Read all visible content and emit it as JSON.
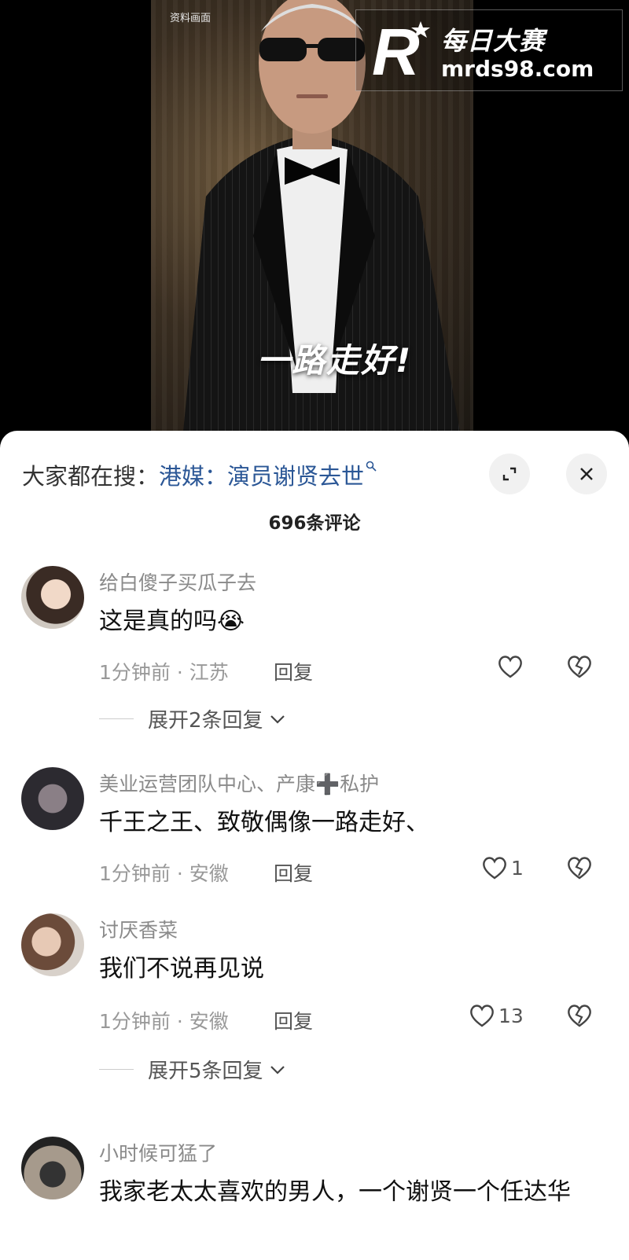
{
  "video": {
    "source_label": "资料画面",
    "caption": "一路走好!",
    "watermark": {
      "logo": "R",
      "name": "每日大赛",
      "url": "mrds98.com"
    }
  },
  "sheet": {
    "search_prefix": "大家都在搜：",
    "search_query": "港媒：演员谢贤去世",
    "search_icon": "search-icon",
    "comment_count": "696条评论"
  },
  "comments": [
    {
      "name": "给白傻子买瓜子去",
      "text": "这是真的吗",
      "emoji": "😭",
      "time": "1分钟前 · 江苏",
      "reply": "回复",
      "likes": "",
      "expand": "展开2条回复"
    },
    {
      "name": "美业运营团队中心、产康➕私护",
      "text": "千王之王、致敬偶像一路走好、",
      "time": "1分钟前 · 安徽",
      "reply": "回复",
      "likes": "1"
    },
    {
      "name": "讨厌香菜",
      "text": "我们不说再见说",
      "time": "1分钟前 · 安徽",
      "reply": "回复",
      "likes": "13",
      "expand": "展开5条回复"
    },
    {
      "name": "小时候可猛了",
      "text": "我家老太太喜欢的男人，一个谢贤一个任达华"
    }
  ]
}
